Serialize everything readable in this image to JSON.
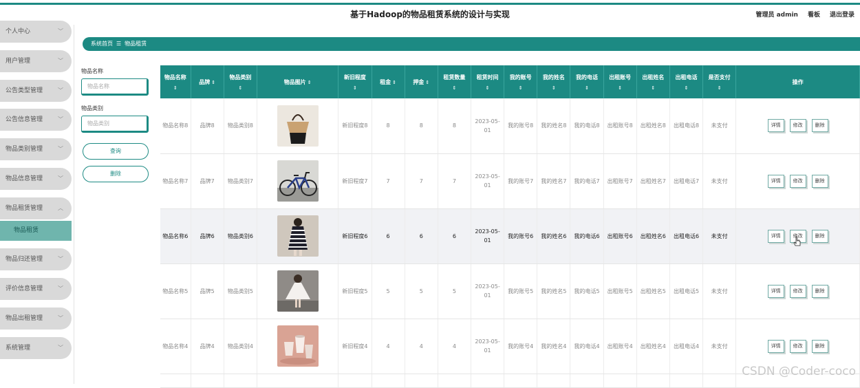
{
  "header": {
    "title": "基于Hadoop的物品租赁系统的设计与实现",
    "admin_label": "管理员 admin",
    "dashboard_label": "看板",
    "logout_label": "退出登录"
  },
  "sidebar": {
    "items": [
      {
        "label": "个人中心",
        "icon": "chevron-down-icon"
      },
      {
        "label": "用户管理",
        "icon": "chevron-down-icon"
      },
      {
        "label": "公告类型管理",
        "icon": "chevron-down-icon"
      },
      {
        "label": "公告信息管理",
        "icon": "chevron-down-icon"
      },
      {
        "label": "物品类别管理",
        "icon": "chevron-down-icon"
      },
      {
        "label": "物品信息管理",
        "icon": "chevron-down-icon"
      },
      {
        "label": "物品租赁管理",
        "icon": "chevron-up-icon"
      },
      {
        "label": "物品归还管理",
        "icon": "chevron-down-icon"
      },
      {
        "label": "评价信息管理",
        "icon": "chevron-down-icon"
      },
      {
        "label": "物品出租管理",
        "icon": "chevron-down-icon"
      },
      {
        "label": "系统管理",
        "icon": "chevron-down-icon"
      }
    ],
    "active_sub": "物品租赁"
  },
  "breadcrumb": {
    "home": "系统首页",
    "separator": "☰",
    "current": "物品租赁"
  },
  "search": {
    "name_label": "物品名称",
    "name_placeholder": "物品名称",
    "category_label": "物品类别",
    "category_placeholder": "物品类别",
    "query_button": "查询",
    "delete_button": "删除"
  },
  "table": {
    "columns": [
      "物品名称",
      "品牌",
      "物品类别",
      "物品图片",
      "新旧程度",
      "租金",
      "押金",
      "租赁数量",
      "租赁时间",
      "我的账号",
      "我的姓名",
      "我的电话",
      "出租账号",
      "出租姓名",
      "出租电话",
      "是否支付",
      "操作"
    ],
    "sort_icon": "⇕",
    "rows": [
      {
        "name": "物品名称8",
        "brand": "品牌8",
        "category": "物品类别8",
        "image": "handbag",
        "condition": "新旧程度8",
        "rent": "8",
        "deposit": "8",
        "qty": "8",
        "time": "2023-05-01",
        "my_account": "我的账号8",
        "my_name": "我的姓名8",
        "my_phone": "我的电话8",
        "lessor_account": "出租账号8",
        "lessor_name": "出租姓名8",
        "lessor_phone": "出租电话8",
        "paid": "未支付"
      },
      {
        "name": "物品名称7",
        "brand": "品牌7",
        "category": "物品类别7",
        "image": "bicycle",
        "condition": "新旧程度7",
        "rent": "7",
        "deposit": "7",
        "qty": "7",
        "time": "2023-05-01",
        "my_account": "我的账号7",
        "my_name": "我的姓名7",
        "my_phone": "我的电话7",
        "lessor_account": "出租账号7",
        "lessor_name": "出租姓名7",
        "lessor_phone": "出租电话7",
        "paid": "未支付"
      },
      {
        "name": "物品名称6",
        "brand": "品牌6",
        "category": "物品类别6",
        "image": "striped-dress",
        "condition": "新旧程度6",
        "rent": "6",
        "deposit": "6",
        "qty": "6",
        "time": "2023-05-01",
        "my_account": "我的账号6",
        "my_name": "我的姓名6",
        "my_phone": "我的电话6",
        "lessor_account": "出租账号6",
        "lessor_name": "出租姓名6",
        "lessor_phone": "出租电话6",
        "paid": "未支付"
      },
      {
        "name": "物品名称5",
        "brand": "品牌5",
        "category": "物品类别5",
        "image": "white-dress",
        "condition": "新旧程度5",
        "rent": "5",
        "deposit": "5",
        "qty": "5",
        "time": "2023-05-01",
        "my_account": "我的账号5",
        "my_name": "我的姓名5",
        "my_phone": "我的电话5",
        "lessor_account": "出租账号5",
        "lessor_name": "出租姓名5",
        "lessor_phone": "出租电话5",
        "paid": "未支付"
      },
      {
        "name": "物品名称4",
        "brand": "品牌4",
        "category": "物品类别4",
        "image": "cups",
        "condition": "新旧程度4",
        "rent": "4",
        "deposit": "4",
        "qty": "4",
        "time": "2023-05-01",
        "my_account": "我的账号4",
        "my_name": "我的姓名4",
        "my_phone": "我的电话4",
        "lessor_account": "出租账号4",
        "lessor_name": "出租姓名4",
        "lessor_phone": "出租电话4",
        "paid": "未支付"
      }
    ],
    "actions": {
      "detail": "详情",
      "edit": "修改",
      "delete": "删除"
    }
  },
  "watermark": "CSDN @Coder-coco",
  "colors": {
    "accent": "#1c8a83",
    "sidebar_bg": "#d9d9d9",
    "active_sub": "#6fb5ad",
    "highlight_row": "#f1f2f5"
  }
}
